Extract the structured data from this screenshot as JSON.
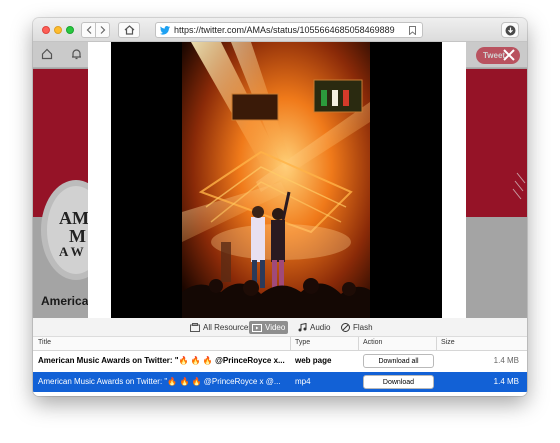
{
  "browser": {
    "url": "https://twitter.com/AMAs/status/1055664685058469889"
  },
  "twitter": {
    "tweet_button": "Tweet",
    "avatar_lines": [
      "AME",
      "M",
      "A W"
    ],
    "profile_name": "America"
  },
  "filters": [
    {
      "label": "All Resources",
      "icon": "all-resources-icon",
      "active": false
    },
    {
      "label": "Video",
      "icon": "video-icon",
      "active": true
    },
    {
      "label": "Audio",
      "icon": "audio-icon",
      "active": false
    },
    {
      "label": "Flash",
      "icon": "flash-icon",
      "active": false
    }
  ],
  "table": {
    "columns": [
      "Title",
      "Type",
      "Action",
      "Size"
    ],
    "rows": [
      {
        "title": "American Music Awards on Twitter: \"🔥 🔥 🔥 @PrinceRoyce x...",
        "type": "web page",
        "action": "Download all",
        "size": "1.4 MB",
        "selected": false
      },
      {
        "title": "American Music Awards on Twitter: \"🔥 🔥 🔥 @PrinceRoyce x @...",
        "type": "mp4",
        "action": "Download",
        "size": "1.4 MB",
        "selected": true
      }
    ]
  },
  "colors": {
    "selection": "#1261d6",
    "twitter_red": "#b61830",
    "tweet_button": "#e26574"
  }
}
